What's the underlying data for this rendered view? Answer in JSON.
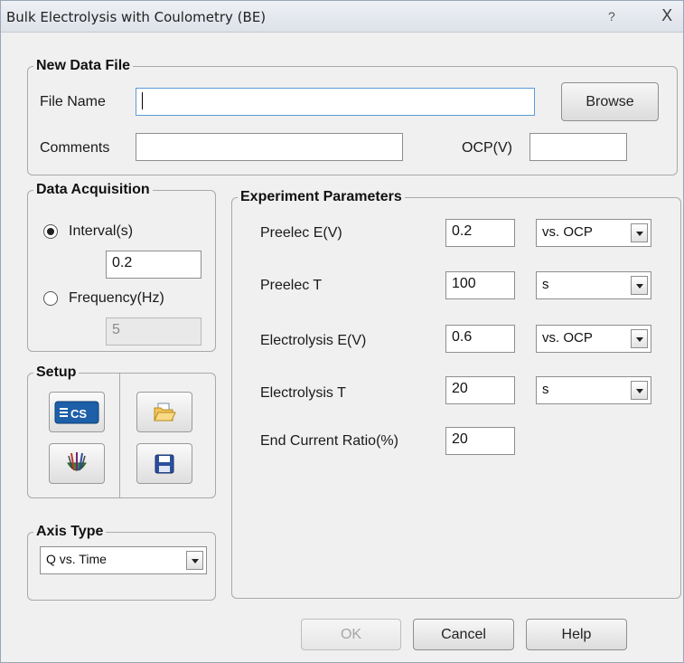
{
  "window": {
    "title": "Bulk Electrolysis with Coulometry (BE)",
    "help_label": "?",
    "close_label": "X"
  },
  "new_data_file": {
    "legend": "New Data File",
    "file_name_label": "File Name",
    "file_name_value": "",
    "browse_label": "Browse",
    "comments_label": "Comments",
    "comments_value": "",
    "ocp_label": "OCP(V)",
    "ocp_value": ""
  },
  "data_acquisition": {
    "legend": "Data Acquisition",
    "interval_label": "Interval(s)",
    "interval_value": "0.2",
    "interval_selected": true,
    "frequency_label": "Frequency(Hz)",
    "frequency_value": "5"
  },
  "setup": {
    "legend": "Setup",
    "icons": [
      "cs-device-icon",
      "open-folder-icon",
      "electrode-icon",
      "save-disk-icon"
    ],
    "cs_text": "CS"
  },
  "axis_type": {
    "legend": "Axis Type",
    "selected": "Q vs. Time"
  },
  "experiment_parameters": {
    "legend": "Experiment Parameters",
    "rows": [
      {
        "label": "Preelec E(V)",
        "value": "0.2",
        "unit": "vs. OCP"
      },
      {
        "label": "Preelec T",
        "value": "100",
        "unit": "s"
      },
      {
        "label": "Electrolysis E(V)",
        "value": "0.6",
        "unit": "vs. OCP"
      },
      {
        "label": "Electrolysis T",
        "value": "20",
        "unit": "s"
      },
      {
        "label": "End Current Ratio(%)",
        "value": "20"
      }
    ]
  },
  "footer": {
    "ok_label": "OK",
    "cancel_label": "Cancel",
    "help_label": "Help"
  },
  "colors": {
    "accent_blue": "#1d5fa8",
    "focus_border": "#5b9bd5",
    "disabled_text": "#a6a6a6"
  }
}
